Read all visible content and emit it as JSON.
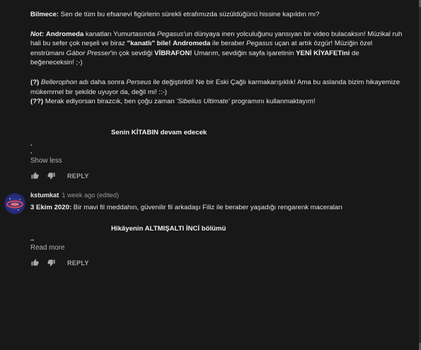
{
  "comment1": {
    "riddle_label": "Bilmece:",
    "riddle_text": " Sen de tüm bu efsanevi figürlerin sürekli etrafımızda süzüldüğünü hissine kapıldın mı?",
    "note": {
      "label": "Not:",
      "s1": " ",
      "andromeda": "Andromeda",
      "s2": " kanatları Yumurtasında ",
      "pegasus": "Pegasus",
      "s3": "'un dünyaya inen yolculuğunu yansıyan bir video bulacaksın! Müzikal ruh hali bu sefer çok neşeli ve biraz ",
      "kanatli": "\"kanatlı\" bile!",
      "s4": " ",
      "andromeda2": "Andromeda",
      "s5": " ile beraber  ",
      "pegasus2": "Pegasus",
      "s6": " uçan at artık özgür! Müziğin özel enstrümanı ",
      "gabor": "Gábor Presser",
      "s7": "'in çok sevdiği ",
      "vibrafon": "VİBRAFON!",
      "s8": " Umarım, sevdiğin sayfa işaretinin ",
      "yeni": "YENİ KİYAFETini",
      "s9": " de beğeneceksin! ;-)"
    },
    "q1": {
      "mark": "(?)",
      "s1": " ",
      "bellerophon": "Bellerophon",
      "s2": " adı daha sonra ",
      "perseus": "Perseus",
      "s3": " ile değiştirildi! Ne bir Eski Çağlı karmakarışıklık! Ama bu aslanda bizim hikayemize mükemmel bir şekilde uyuyor da, değil mi! ::-)"
    },
    "q2": {
      "mark": "(??)",
      "s1": " Merak ediyorsan birazcık, ben çoğu zaman ",
      "sibelius": "'Sibelius Ultimate'",
      "s2": " programını kullanmaktayım!"
    },
    "continue_text": "Senin KİTABIN devam edecek",
    "dot": ".",
    "show_less": "Show less",
    "reply_label": "REPLY"
  },
  "comment2": {
    "author": "kstumkat",
    "meta": "1 week ago (edited)",
    "date": "3 Ekim 2020:",
    "text": " Bir mavi fil meddahın, güvenilir fil arkadaşı Filiz ile beraber yaşadığı rengarenk maceraları",
    "episode": "Hikâyenin ALTMIŞALTI İNCİ bölümü",
    "dash": "–",
    "read_more": "Read more",
    "reply_label": "REPLY"
  },
  "icons": {
    "like": "thumb-up-icon",
    "dislike": "thumb-down-icon",
    "avatar": "galaxy-avatar"
  },
  "colors": {
    "background": "#181818",
    "text": "#e6e6e6",
    "muted": "#a8a8a8"
  }
}
